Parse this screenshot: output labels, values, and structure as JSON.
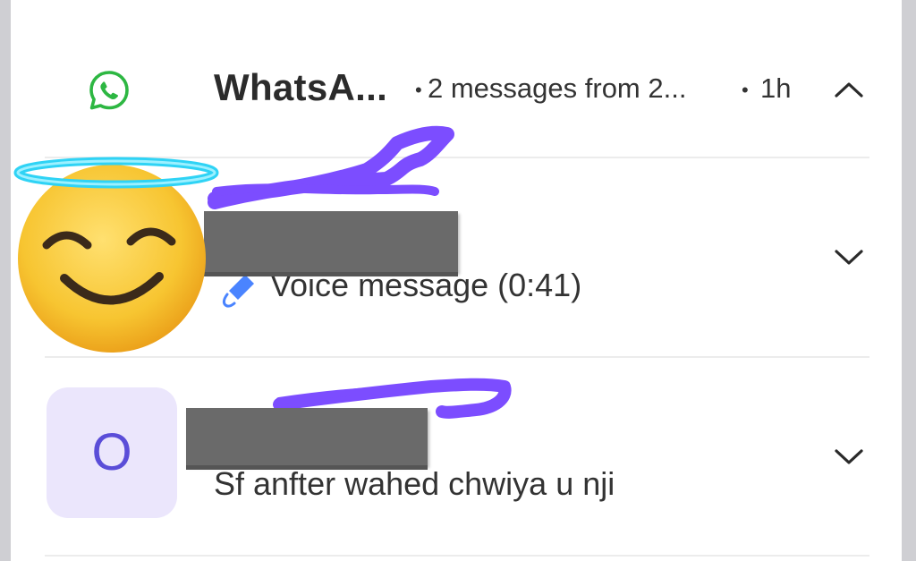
{
  "notification": {
    "app_name": "WhatsA...",
    "summary": "2 messages from 2...",
    "time": "1h",
    "separator": "•",
    "icons": {
      "app": "whatsapp-icon",
      "collapse": "chevron-up-icon",
      "expand": "chevron-down-icon"
    }
  },
  "messages": [
    {
      "text": "Voice message (0:41)",
      "leading_icon": "microphone-icon",
      "avatar": "emoji-smiling-halo"
    },
    {
      "text": "Sf anfter wahed chwiya u nji",
      "avatar_letter": "O"
    }
  ],
  "colors": {
    "whatsapp_green": "#2db742",
    "avatar_bg": "#ebe6fc",
    "avatar_letter": "#5a4dd8",
    "scribble_purple": "#7c4dff",
    "redaction_gray": "#6a6a6a"
  }
}
